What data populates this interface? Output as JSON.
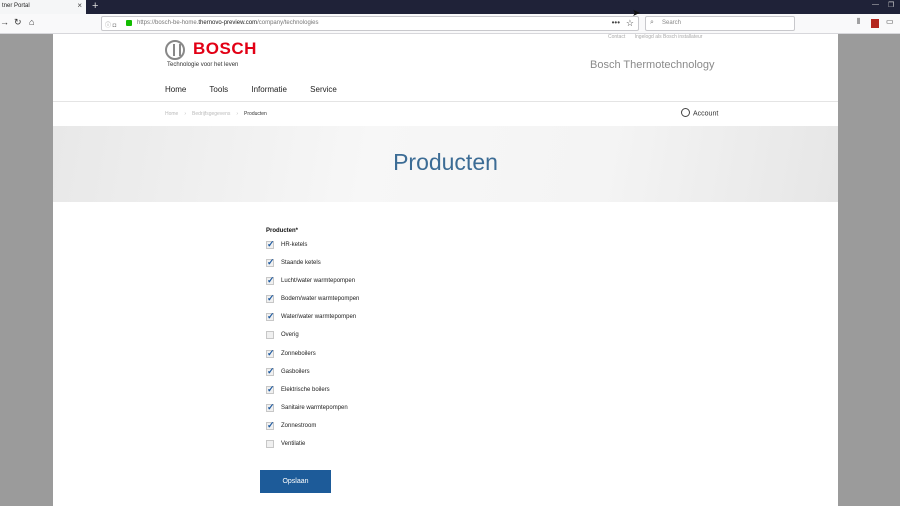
{
  "browser": {
    "tab_title": "tner Portal",
    "tab_close": "×",
    "new_tab": "+",
    "url_prefix": "https://bosch-be-home.",
    "url_host": "thernovo-preview.com",
    "url_path": "/company/technologies",
    "url_more": "•••",
    "search_placeholder": "Search"
  },
  "header": {
    "logo_text": "BOSCH",
    "slogan": "Technologie voor het leven",
    "top_links": [
      "Contact",
      "Ingelogd als Bosch installateur"
    ],
    "company_name": "Bosch Thermotechnology",
    "nav": [
      "Home",
      "Tools",
      "Informatie",
      "Service"
    ],
    "breadcrumb": [
      "Home",
      "Bedrijfsgegevens",
      "Producten"
    ],
    "account_label": "Account"
  },
  "hero": {
    "title": "Producten"
  },
  "form": {
    "label": "Producten*",
    "options": [
      {
        "label": "HR-ketels",
        "checked": true
      },
      {
        "label": "Staande ketels",
        "checked": true
      },
      {
        "label": "Lucht/water warmtepompen",
        "checked": true
      },
      {
        "label": "Bodem/water warmtepompen",
        "checked": true
      },
      {
        "label": "Water/water warmtepompen",
        "checked": true
      },
      {
        "label": "Overig",
        "checked": false
      },
      {
        "label": "Zonneboilers",
        "checked": true
      },
      {
        "label": "Gasboilers",
        "checked": true
      },
      {
        "label": "Elektrische boilers",
        "checked": true
      },
      {
        "label": "Sanitaire warmtepompen",
        "checked": true
      },
      {
        "label": "Zonnestroom",
        "checked": true
      },
      {
        "label": "Ventilatie",
        "checked": false
      }
    ],
    "save_label": "Opslaan"
  }
}
